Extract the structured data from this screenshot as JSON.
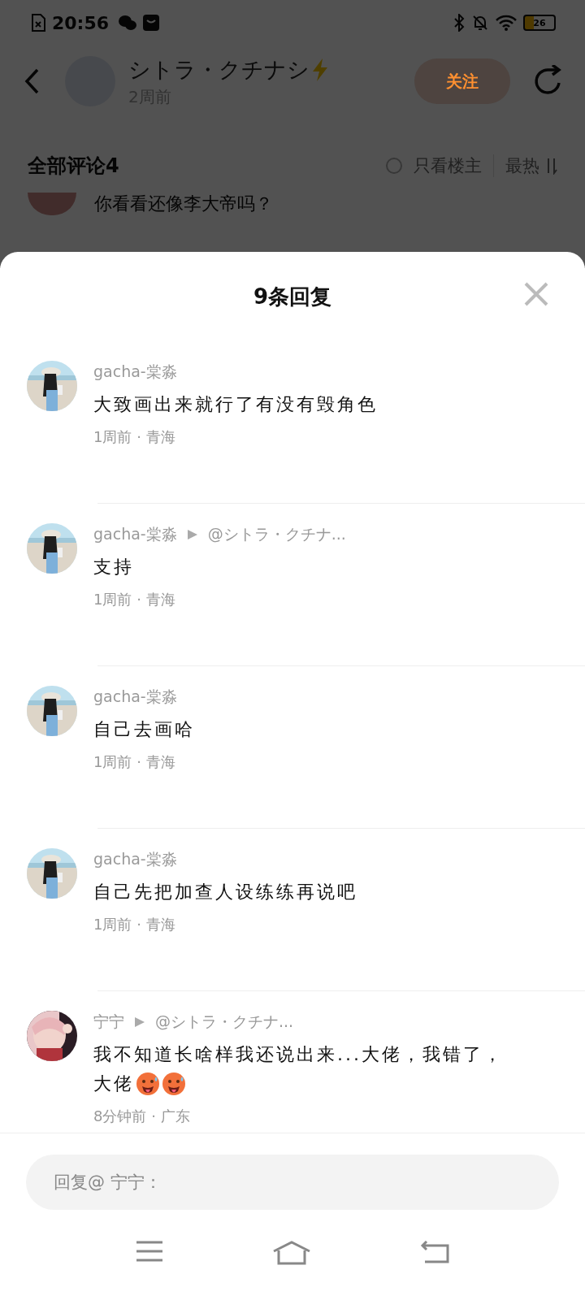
{
  "status_bar": {
    "time": "20:56",
    "battery": "26"
  },
  "post_header": {
    "author": "シトラ・クチナシ",
    "time": "2周前",
    "follow_button": "关注"
  },
  "comments_bar": {
    "title": "全部评论4",
    "owner_only": {
      "label": "只看楼主",
      "checked": false
    },
    "sort": "最热"
  },
  "background_comment": {
    "content": "你看看还像李大帝吗？"
  },
  "reply_sheet": {
    "title": "9条回复",
    "replies": [
      {
        "author": "gacha-棠淼",
        "color": "#bfe0ee",
        "content": "大致画出来就行了有没有毁角色",
        "time": "1周前 · 青海"
      },
      {
        "author": "gacha-棠淼",
        "color": "#bfe0ee",
        "reply_to": "@シトラ・クチナ...",
        "content": "支持",
        "time": "1周前 · 青海"
      },
      {
        "author": "gacha-棠淼",
        "color": "#bfe0ee",
        "content": "自己去画哈",
        "time": "1周前 · 青海"
      },
      {
        "author": "gacha-棠淼",
        "color": "#bfe0ee",
        "content": "自己先把加查人设练练再说吧",
        "time": "1周前 · 青海"
      },
      {
        "author": "宁宁",
        "color": "#e9c7c9",
        "reply_to": "@シトラ・クチナ...",
        "content": "我不知道长啥样我还说出来...大佬，我错了，",
        "content_continued": "大佬",
        "emojis": [
          {
            "kind": "hot-face"
          },
          {
            "kind": "hot-face"
          }
        ],
        "time": "8分钟前 · 广东"
      }
    ],
    "reply_field": {
      "placeholder": "回复@ 宁宁："
    }
  }
}
